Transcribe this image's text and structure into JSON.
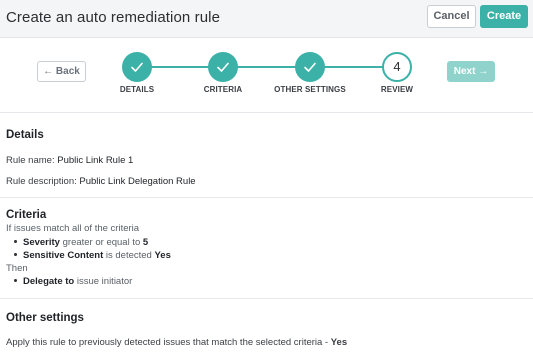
{
  "header": {
    "title": "Create an auto remediation rule",
    "cancel_label": "Cancel",
    "create_label": "Create"
  },
  "stepper": {
    "back_label": "← Back",
    "next_label": "Next →",
    "steps": [
      {
        "label": "DETAILS",
        "state": "done",
        "icon": "check-icon"
      },
      {
        "label": "CRITERIA",
        "state": "done",
        "icon": "check-icon"
      },
      {
        "label": "OTHER SETTINGS",
        "state": "done",
        "icon": "check-icon"
      },
      {
        "label": "REVIEW",
        "state": "current",
        "number": "4"
      }
    ]
  },
  "details": {
    "title": "Details",
    "rule_name_label": "Rule name:",
    "rule_name_value": "Public Link Rule 1",
    "rule_desc_label": "Rule description:",
    "rule_desc_value": "Public Link Delegation Rule"
  },
  "criteria": {
    "title": "Criteria",
    "intro": "If issues match all of the criteria",
    "conditions": [
      {
        "field": "Severity",
        "operator": "greater or equal to",
        "value": "5"
      },
      {
        "field": "Sensitive Content",
        "operator": "is detected",
        "value": "Yes"
      }
    ],
    "then_label": "Then",
    "actions": [
      {
        "action": "Delegate to",
        "target": "issue initiator"
      }
    ]
  },
  "other_settings": {
    "title": "Other settings",
    "apply_text": "Apply this rule to previously detected issues that match the selected criteria -",
    "apply_value": "Yes"
  },
  "colors": {
    "accent": "#3bb1a8",
    "accent_disabled": "#8fd3cc"
  }
}
